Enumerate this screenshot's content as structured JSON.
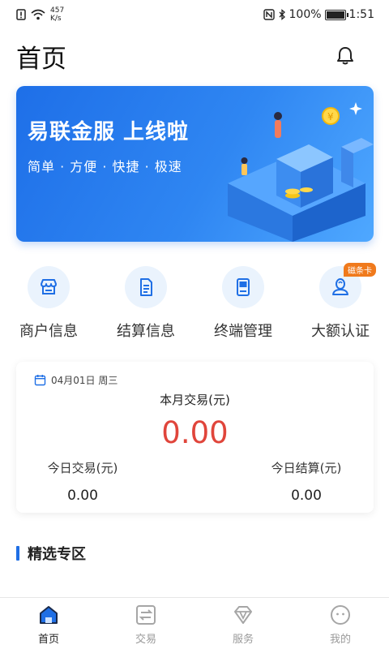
{
  "status_bar": {
    "net_speed_value": "457",
    "net_speed_unit": "K/s",
    "nfc": "N",
    "battery": "100%",
    "time": "1:51"
  },
  "header": {
    "title": "首页"
  },
  "banner": {
    "title": "易联金服 上线啦",
    "subtitle": "简单 · 方便 · 快捷 · 极速"
  },
  "quick_menu": [
    {
      "label": "商户信息",
      "icon": "store-icon"
    },
    {
      "label": "结算信息",
      "icon": "document-icon"
    },
    {
      "label": "终端管理",
      "icon": "pos-terminal-icon"
    },
    {
      "label": "大额认证",
      "icon": "user-verify-icon",
      "badge": "磁条卡"
    }
  ],
  "stats": {
    "date": "04月01日 周三",
    "month_label": "本月交易(元)",
    "month_value": "0.00",
    "today_trade_label": "今日交易(元)",
    "today_trade_value": "0.00",
    "today_settle_label": "今日结算(元)",
    "today_settle_value": "0.00"
  },
  "section": {
    "title": "精选专区"
  },
  "tabs": [
    {
      "label": "首页",
      "icon": "home-icon",
      "active": true
    },
    {
      "label": "交易",
      "icon": "transfer-icon",
      "active": false
    },
    {
      "label": "服务",
      "icon": "diamond-icon",
      "active": false
    },
    {
      "label": "我的",
      "icon": "profile-icon",
      "active": false
    }
  ],
  "colors": {
    "accent": "#1f6fe5",
    "amount": "#e0453b",
    "badge": "#f07a1c"
  }
}
